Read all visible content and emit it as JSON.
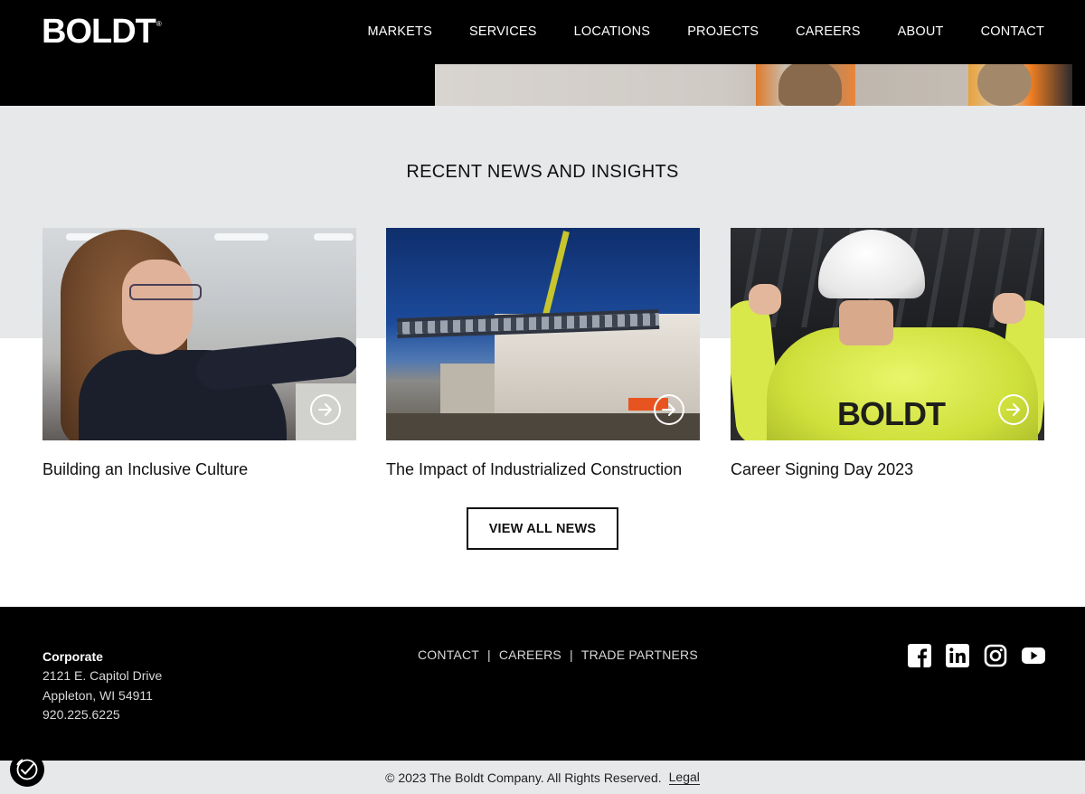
{
  "header": {
    "logo": "BOLDT",
    "logo_mark": "®",
    "nav": [
      "MARKETS",
      "SERVICES",
      "LOCATIONS",
      "PROJECTS",
      "CAREERS",
      "ABOUT",
      "CONTACT"
    ]
  },
  "news": {
    "title": "RECENT NEWS AND INSIGHTS",
    "cards": [
      {
        "caption": "Building an Inclusive Culture",
        "icon": "arrow-circle-icon"
      },
      {
        "caption": "The Impact of Industrialized Construction",
        "icon": "arrow-circle-icon"
      },
      {
        "caption": "Career Signing Day 2023",
        "icon": "arrow-circle-icon",
        "shirt_text": "BOLDT"
      }
    ],
    "view_all": "VIEW ALL NEWS"
  },
  "footer": {
    "address": {
      "heading": "Corporate",
      "line1": "2121 E. Capitol Drive",
      "line2": "Appleton, WI 54911",
      "phone": "920.225.6225"
    },
    "links": [
      "CONTACT",
      "CAREERS",
      "TRADE PARTNERS"
    ],
    "separator": "|",
    "social": [
      "facebook-icon",
      "linkedin-icon",
      "instagram-icon",
      "youtube-icon"
    ],
    "copyright": "© 2023 The Boldt Company. All Rights Reserved.",
    "legal": "Legal"
  },
  "colors": {
    "header_bg": "#000000",
    "section_bg": "#e6e8ea",
    "footer_bg": "#000000"
  }
}
